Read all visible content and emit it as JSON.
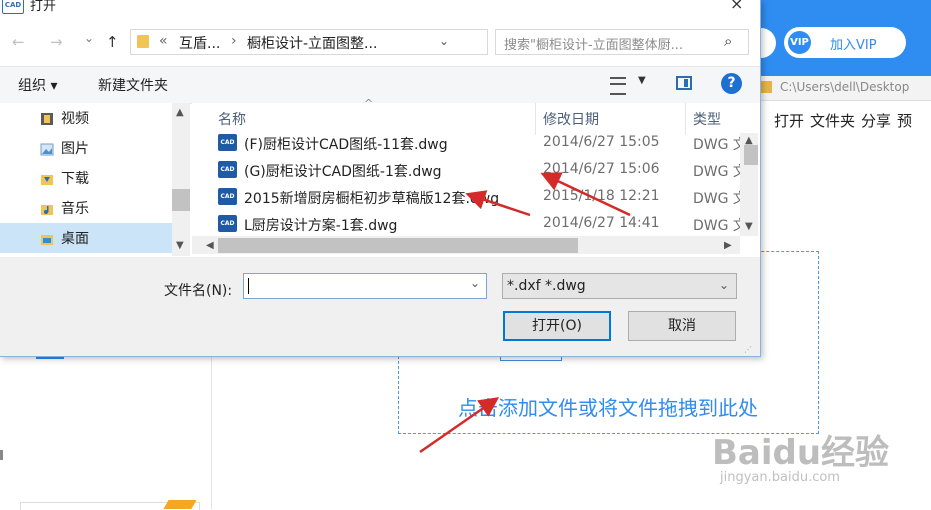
{
  "background_app": {
    "vip_badge": "VIP",
    "vip_label": "加入VIP",
    "address_text": "C:\\Users\\dell\\Desktop",
    "menu": [
      "打开",
      "文件夹",
      "分享",
      "预"
    ],
    "drop_text": "点击添加文件或将文件拖拽到此处",
    "watermark": "Baidu经验",
    "watermark_sub": "jingyan.baidu.com"
  },
  "dialog": {
    "app_icon": "CAD",
    "title": "打开",
    "close": "×",
    "nav": {
      "back": "←",
      "forward": "→",
      "recent": "⌄",
      "up": "↑"
    },
    "breadcrumb": [
      "«",
      "互盾...",
      "›",
      "橱柜设计-立面图整..."
    ],
    "refresh": "↻",
    "search_placeholder": "搜索\"橱柜设计-立面图整体厨...",
    "search_icon": "⌕",
    "toolbar": {
      "organize": "组织 ▾",
      "new_folder": "新建文件夹",
      "help": "?"
    },
    "tree": [
      {
        "label": "视频",
        "icon": "video-folder-icon"
      },
      {
        "label": "图片",
        "icon": "pictures-folder-icon"
      },
      {
        "label": "下载",
        "icon": "downloads-folder-icon"
      },
      {
        "label": "音乐",
        "icon": "music-folder-icon"
      },
      {
        "label": "桌面",
        "icon": "desktop-folder-icon",
        "selected": true
      }
    ],
    "columns": {
      "name": "名称",
      "date": "修改日期",
      "type": "类型"
    },
    "files": [
      {
        "name": "(F)厨柜设计CAD图纸-11套.dwg",
        "date": "2014/6/27 15:05",
        "type": "DWG 文"
      },
      {
        "name": "(G)厨柜设计CAD图纸-1套.dwg",
        "date": "2014/6/27 15:06",
        "type": "DWG 文"
      },
      {
        "name": "2015新增厨房橱柜初步草稿版12套.dwg",
        "date": "2015/1/18 12:21",
        "type": "DWG 文"
      },
      {
        "name": "L厨房设计方案-1套.dwg",
        "date": "2014/6/27 14:41",
        "type": "DWG 文"
      }
    ],
    "file_icon_text": "CAD",
    "filename_label": "文件名(N):",
    "filename_value": "",
    "filter": "*.dxf *.dwg",
    "open_button": "打开(O)",
    "cancel_button": "取消"
  },
  "colors": {
    "accent": "#2f8cf0",
    "arrow": "#d42a2a",
    "selection": "#cce4f7"
  }
}
